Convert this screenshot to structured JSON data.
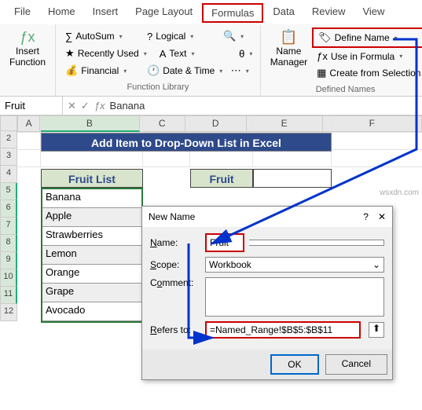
{
  "tabs": [
    "File",
    "Home",
    "Insert",
    "Page Layout",
    "Formulas",
    "Data",
    "Review",
    "View"
  ],
  "active_tab": "Formulas",
  "ribbon": {
    "insert_function": {
      "label1": "Insert",
      "label2": "Function"
    },
    "library": {
      "autosum": "AutoSum",
      "recent": "Recently Used",
      "financial": "Financial",
      "logical": "Logical",
      "text": "Text",
      "datetime": "Date & Time",
      "group_label": "Function Library"
    },
    "name_manager": {
      "label1": "Name",
      "label2": "Manager"
    },
    "defined": {
      "define_name": "Define Name",
      "use_in_formula": "Use in Formula",
      "create_from_selection": "Create from Selection",
      "group_label": "Defined Names"
    }
  },
  "namebox": "Fruit",
  "formula_value": "Banana",
  "columns": [
    "A",
    "B",
    "C",
    "D",
    "E",
    "F"
  ],
  "rows": [
    "2",
    "3",
    "4",
    "5",
    "6",
    "7",
    "8",
    "9",
    "10",
    "11",
    "12"
  ],
  "title_cell": "Add Item to Drop-Down List in Excel",
  "fruit_list_header": "Fruit List",
  "fruit_header": "Fruit",
  "fruit_list": [
    "Banana",
    "Apple",
    "Strawberries",
    "Lemon",
    "Orange",
    "Grape",
    "Avocado"
  ],
  "dialog": {
    "title": "New Name",
    "name_label": "Name:",
    "name_value": "Fruit",
    "scope_label": "Scope:",
    "scope_value": "Workbook",
    "comment_label": "Comment:",
    "refers_label": "Refers to:",
    "refers_value": "=Named_Range!$B$5:$B$11",
    "ok": "OK",
    "cancel": "Cancel"
  },
  "watermark": "wsxdn.com"
}
